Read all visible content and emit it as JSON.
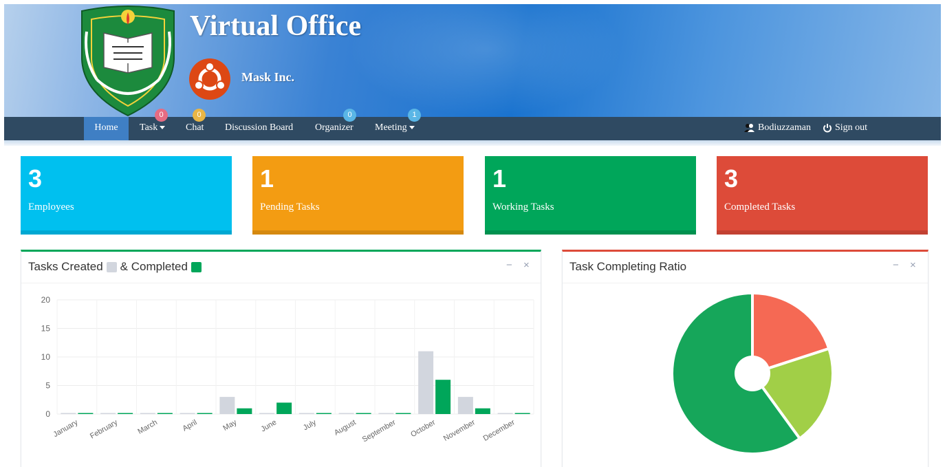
{
  "header": {
    "app_title": "Virtual Office",
    "company_name": "Mask Inc.",
    "crest_icon": "university-crest-icon",
    "company_logo_icon": "ubuntu-logo-icon",
    "gradient_colors": [
      "#b6d0ec",
      "#1a73cf",
      "#86b6e7"
    ]
  },
  "nav": {
    "items": [
      {
        "label": "Home",
        "active": true
      },
      {
        "label": "Task",
        "badge": "0",
        "dropdown": true
      },
      {
        "label": "Chat",
        "badge": "0"
      },
      {
        "label": "Discussion Board"
      },
      {
        "label": "Organizer",
        "badge": "0"
      },
      {
        "label": "Meeting",
        "badge": "1",
        "dropdown": true
      }
    ],
    "user_name": "Bodiuzzaman",
    "signout_label": "Sign out",
    "colors": {
      "bar": "#2f4a62",
      "active": "#3f7fc4"
    }
  },
  "stats": [
    {
      "value": "3",
      "label": "Employees",
      "color": "#00c0ef"
    },
    {
      "value": "1",
      "label": "Pending Tasks",
      "color": "#f39c12"
    },
    {
      "value": "1",
      "label": "Working Tasks",
      "color": "#00a65a"
    },
    {
      "value": "3",
      "label": "Completed Tasks",
      "color": "#dd4b39"
    }
  ],
  "panels": {
    "bar_title_part1": "Tasks Created",
    "bar_title_part2": "& Completed",
    "pie_title": "Task Completing Ratio",
    "minimize_glyph": "−",
    "close_glyph": "×"
  },
  "chart_data": [
    {
      "type": "bar",
      "categories": [
        "January",
        "February",
        "March",
        "April",
        "May",
        "June",
        "July",
        "August",
        "September",
        "October",
        "November",
        "December"
      ],
      "series": [
        {
          "name": "Tasks Created",
          "color": "#d2d6de",
          "values": [
            0,
            0,
            0,
            0,
            3,
            0,
            0,
            0,
            0,
            11,
            3,
            0
          ]
        },
        {
          "name": "Completed",
          "color": "#00a65a",
          "values": [
            0,
            0,
            0,
            0,
            1,
            2,
            0,
            0,
            0,
            6,
            1,
            0
          ]
        }
      ],
      "ylim": [
        0,
        20
      ],
      "yticks": [
        0,
        5,
        10,
        15,
        20
      ],
      "grid": true
    },
    {
      "type": "pie",
      "doughnut": true,
      "slices": [
        {
          "value": 20,
          "color": "#f56954"
        },
        {
          "value": 20,
          "color": "#a1cf47"
        },
        {
          "value": 60,
          "color": "#16a65a"
        }
      ]
    }
  ]
}
